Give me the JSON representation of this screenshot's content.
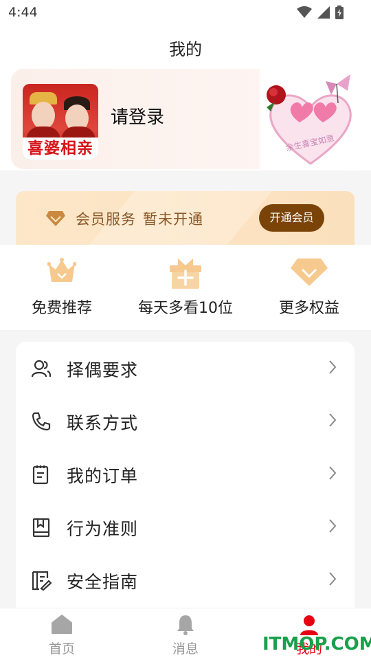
{
  "status_bar": {
    "time": "4:44",
    "icons": [
      "wifi-icon",
      "signal-icon",
      "battery-icon"
    ]
  },
  "header": {
    "title": "我的"
  },
  "profile": {
    "avatar_text": "喜婆相亲",
    "login_label": "请登录",
    "decoration_text": "余生喜宝如意"
  },
  "vip": {
    "service_label": "会员服务",
    "status": "暂未开通",
    "button_label": "开通会员"
  },
  "benefits": [
    {
      "icon": "crown-icon",
      "label": "免费推荐"
    },
    {
      "icon": "gift-icon",
      "label": "每天多看10位"
    },
    {
      "icon": "diamond-icon",
      "label": "更多权益"
    }
  ],
  "menu": [
    {
      "icon": "users-icon",
      "label": "择偶要求"
    },
    {
      "icon": "phone-icon",
      "label": "联系方式"
    },
    {
      "icon": "order-icon",
      "label": "我的订单"
    },
    {
      "icon": "book-icon",
      "label": "行为准则"
    },
    {
      "icon": "guide-icon",
      "label": "安全指南"
    }
  ],
  "tabs": [
    {
      "icon": "home-icon",
      "label": "首页",
      "active": false
    },
    {
      "icon": "bell-icon",
      "label": "消息",
      "active": false
    },
    {
      "icon": "user-icon",
      "label": "我的",
      "active": true
    }
  ],
  "watermark": "ITMOP.COM",
  "colors": {
    "accent": "#e60012",
    "vip_button": "#7a4308",
    "vip_text": "#8a5a2a",
    "benefit_icon": "#f0b872"
  }
}
